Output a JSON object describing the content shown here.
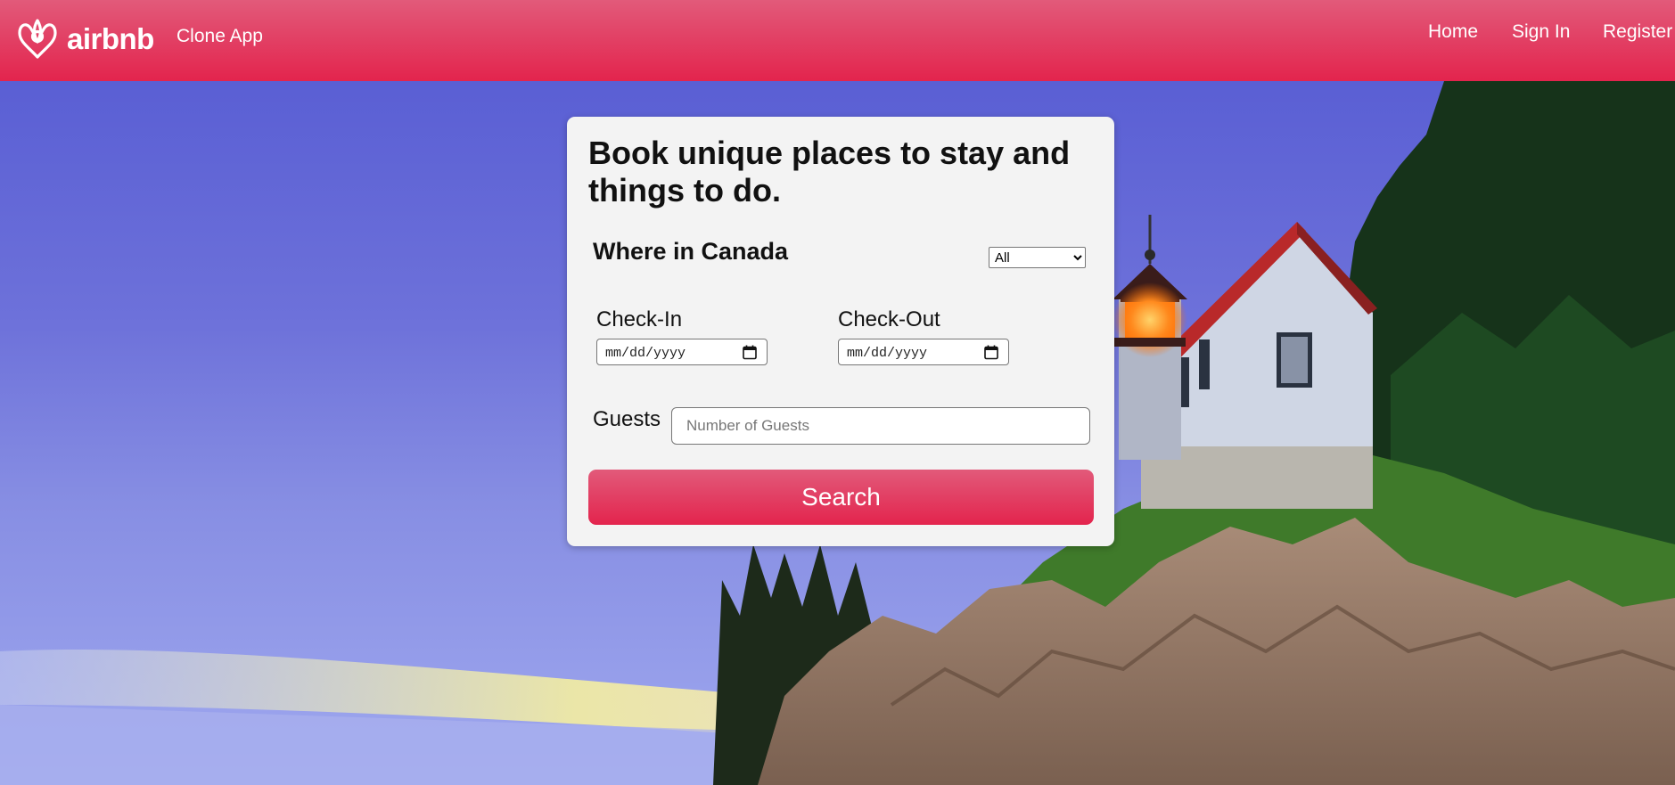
{
  "navbar": {
    "brand": "airbnb",
    "app_name": "Clone App",
    "links": [
      "Home",
      "Sign In",
      "Register"
    ]
  },
  "search_card": {
    "headline": "Book unique places to stay and things to do.",
    "where_label": "Where in Canada",
    "region_options": [
      "All"
    ],
    "region_selected": "All",
    "checkin_label": "Check-In",
    "checkout_label": "Check-Out",
    "date_placeholder": "mm/dd/yyyy",
    "guests_label": "Guests",
    "guests_placeholder": "Number of Guests",
    "search_label": "Search"
  },
  "colors": {
    "brand_primary": "#e3244d",
    "brand_light": "#e25a7a",
    "card_background": "#f3f3f3"
  },
  "icons": {
    "logo": "airbnb-belo-icon",
    "date_picker": "calendar-icon"
  },
  "hero_image": "lighthouse-on-rocky-cliff-at-dusk"
}
